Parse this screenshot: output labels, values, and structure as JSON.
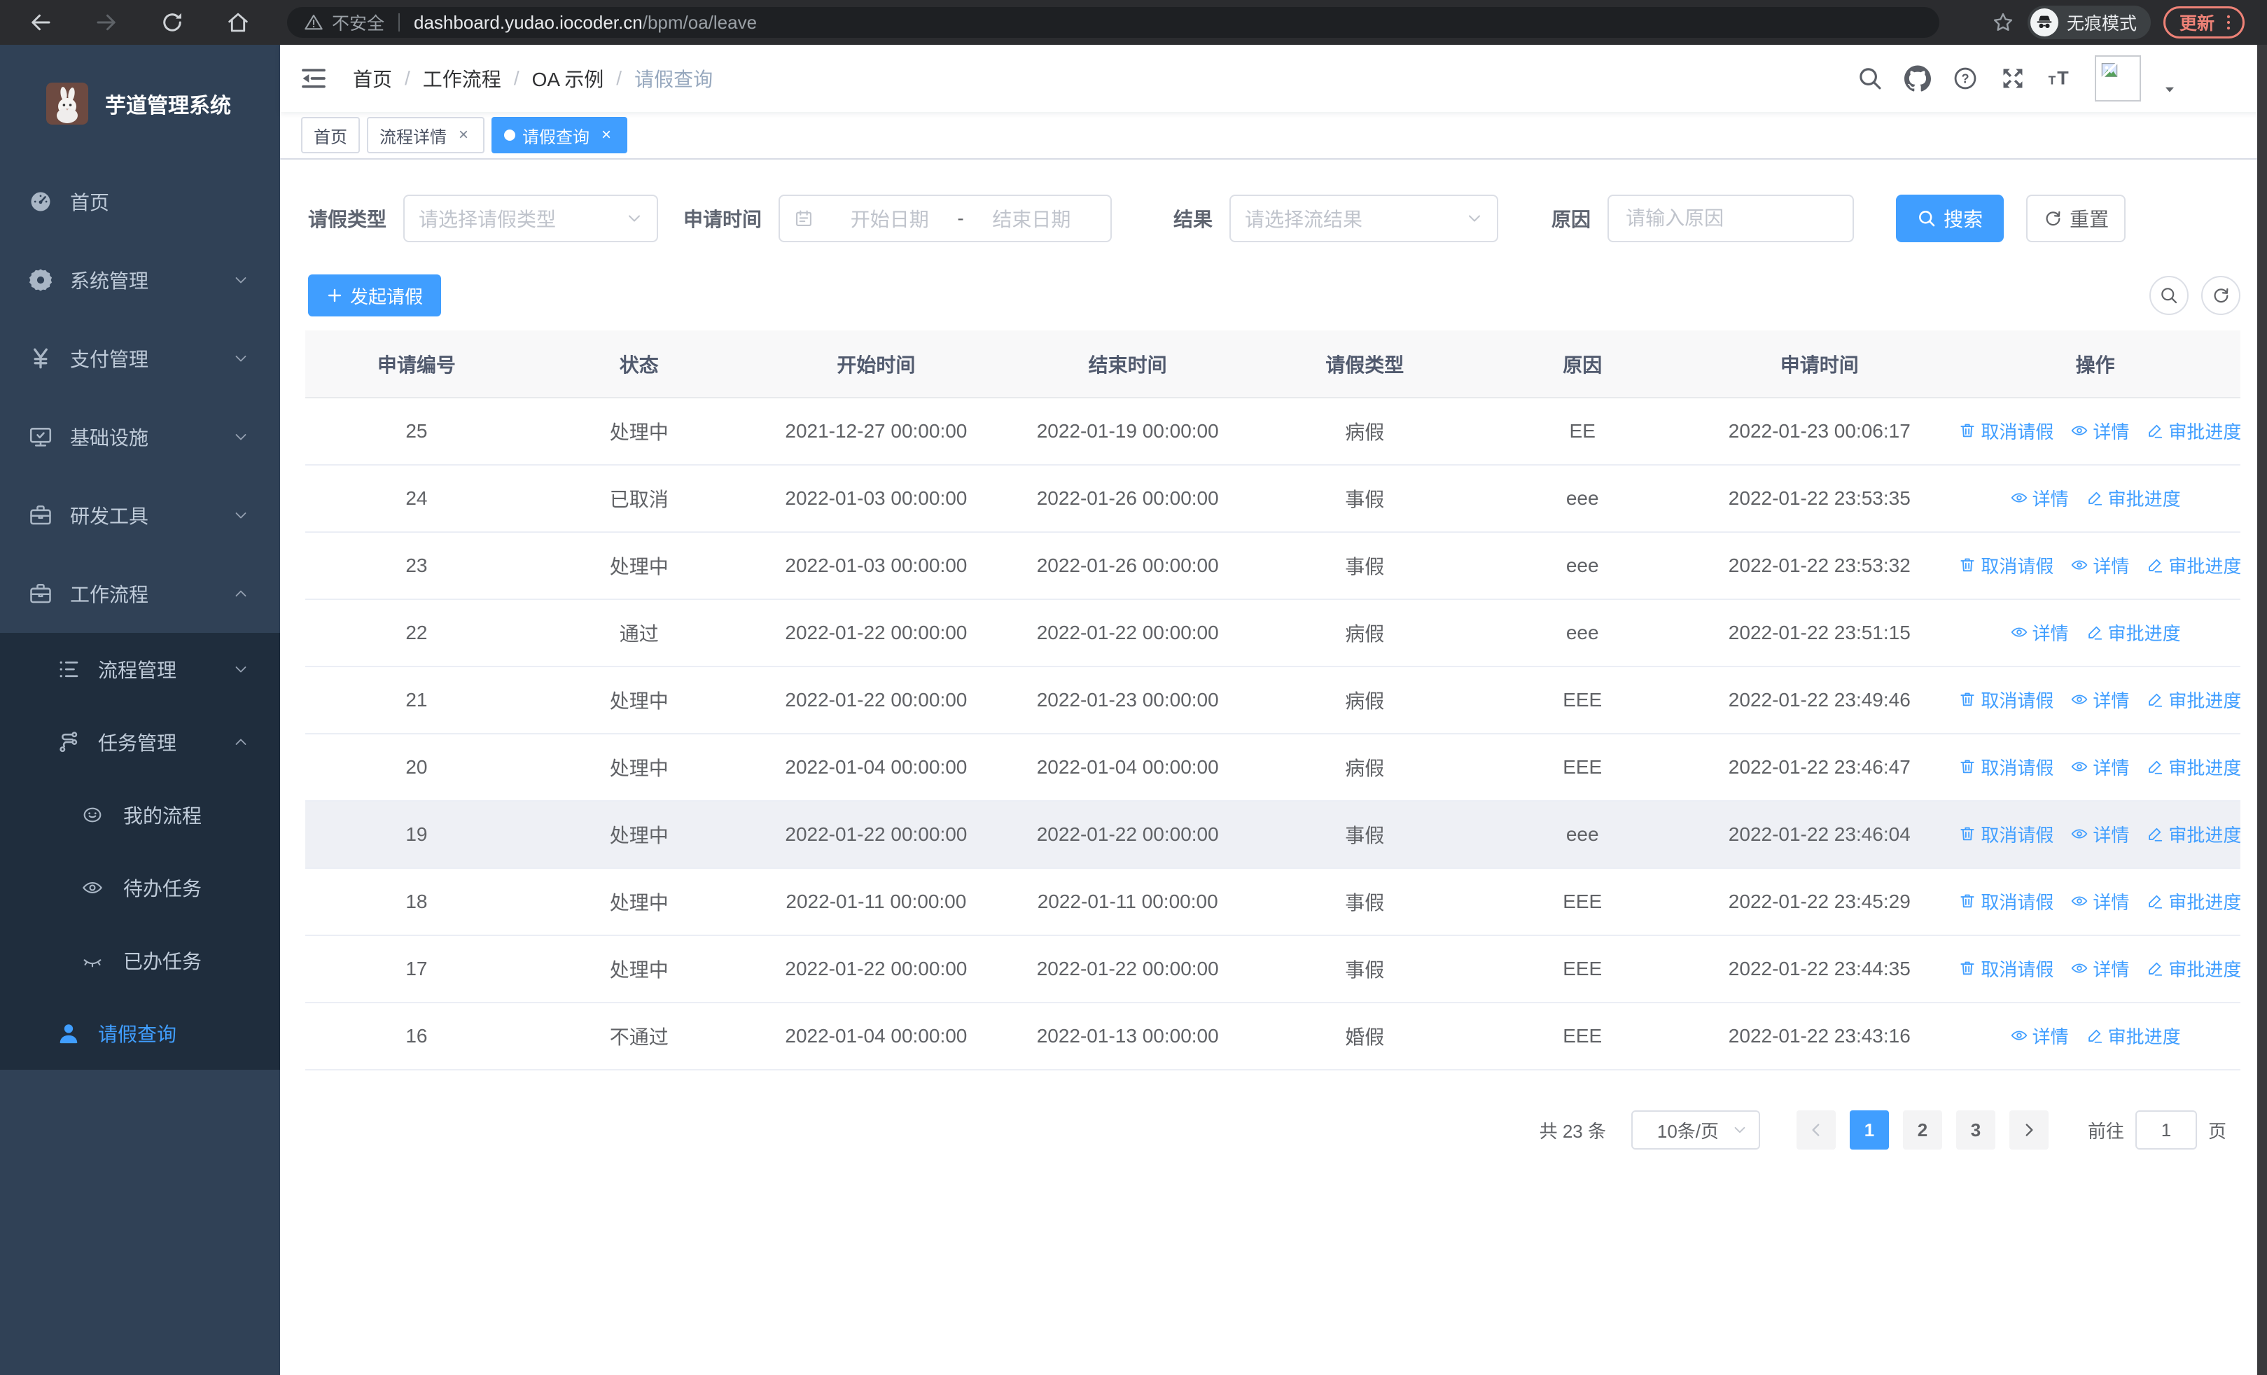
{
  "browser": {
    "security_label": "不安全",
    "url_host": "dashboard.yudao.iocoder.cn",
    "url_path": "/bpm/oa/leave",
    "incognito_label": "无痕模式",
    "update_label": "更新"
  },
  "colors": {
    "primary": "#409EFF",
    "sidebar_bg": "#304156",
    "submenu_bg": "#1f2d3d",
    "update_accent": "#ee8277"
  },
  "sidebar": {
    "app_title": "芋道管理系统",
    "items": [
      {
        "key": "home",
        "label": "首页",
        "icon": "dashboard-icon",
        "level": 1,
        "submenu": false,
        "chevron": "",
        "active": false
      },
      {
        "key": "system-management",
        "label": "系统管理",
        "icon": "gear-icon",
        "level": 1,
        "submenu": false,
        "chevron": "down",
        "active": false
      },
      {
        "key": "payment-management",
        "label": "支付管理",
        "icon": "yen-icon",
        "level": 1,
        "submenu": false,
        "chevron": "down",
        "active": false
      },
      {
        "key": "infrastructure",
        "label": "基础设施",
        "icon": "monitor-icon",
        "level": 1,
        "submenu": false,
        "chevron": "down",
        "active": false
      },
      {
        "key": "dev-tools",
        "label": "研发工具",
        "icon": "briefcase-icon",
        "level": 1,
        "submenu": false,
        "chevron": "down",
        "active": false
      },
      {
        "key": "workflow",
        "label": "工作流程",
        "icon": "briefcase-icon",
        "level": 1,
        "submenu": false,
        "chevron": "up",
        "active": false
      },
      {
        "key": "process-management",
        "label": "流程管理",
        "icon": "tree-list-icon",
        "level": 2,
        "submenu": true,
        "chevron": "down",
        "active": false
      },
      {
        "key": "task-management",
        "label": "任务管理",
        "icon": "flow-icon",
        "level": 2,
        "submenu": true,
        "chevron": "up",
        "active": false
      },
      {
        "key": "my-process",
        "label": "我的流程",
        "icon": "robot-face-icon",
        "level": 3,
        "submenu": true,
        "chevron": "",
        "active": false
      },
      {
        "key": "todo-tasks",
        "label": "待办任务",
        "icon": "eye-open-icon",
        "level": 3,
        "submenu": true,
        "chevron": "",
        "active": false
      },
      {
        "key": "done-tasks",
        "label": "已办任务",
        "icon": "eye-closed-icon",
        "level": 3,
        "submenu": true,
        "chevron": "",
        "active": false
      },
      {
        "key": "leave-query",
        "label": "请假查询",
        "icon": "user-icon",
        "level": 2,
        "submenu": true,
        "chevron": "",
        "active": true
      }
    ]
  },
  "breadcrumb": {
    "items": [
      "首页",
      "工作流程",
      "OA 示例",
      "请假查询"
    ]
  },
  "tabs": [
    {
      "key": "home-tab",
      "label": "首页",
      "closable": false,
      "active": false
    },
    {
      "key": "process-detail-tab",
      "label": "流程详情",
      "closable": true,
      "active": false
    },
    {
      "key": "leave-query-tab",
      "label": "请假查询",
      "closable": true,
      "active": true
    }
  ],
  "filters": {
    "leave_type_label": "请假类型",
    "leave_type_placeholder": "请选择请假类型",
    "apply_time_label": "申请时间",
    "start_date_placeholder": "开始日期",
    "range_separator": "-",
    "end_date_placeholder": "结束日期",
    "result_label": "结果",
    "result_placeholder": "请选择流结果",
    "reason_label": "原因",
    "reason_placeholder": "请输入原因",
    "search_label": "搜索",
    "reset_label": "重置"
  },
  "toolbar": {
    "create_label": "发起请假"
  },
  "table": {
    "columns": [
      "申请编号",
      "状态",
      "开始时间",
      "结束时间",
      "请假类型",
      "原因",
      "申请时间",
      "操作"
    ],
    "action_defs": {
      "cancel": {
        "label": "取消请假",
        "icon": "trash-icon",
        "name": "cancel-leave-link"
      },
      "detail": {
        "label": "详情",
        "icon": "eye-icon",
        "name": "detail-link"
      },
      "progress": {
        "label": "审批进度",
        "icon": "edit-icon",
        "name": "approval-progress-link"
      }
    },
    "rows": [
      {
        "id": "25",
        "status": "处理中",
        "start_time": "2021-12-27 00:00:00",
        "end_time": "2022-01-19 00:00:00",
        "leave_type": "病假",
        "reason": "EE",
        "apply_time": "2022-01-23 00:06:17",
        "actions": [
          "cancel",
          "detail",
          "progress"
        ],
        "highlight": false
      },
      {
        "id": "24",
        "status": "已取消",
        "start_time": "2022-01-03 00:00:00",
        "end_time": "2022-01-26 00:00:00",
        "leave_type": "事假",
        "reason": "eee",
        "apply_time": "2022-01-22 23:53:35",
        "actions": [
          "detail",
          "progress"
        ],
        "highlight": false
      },
      {
        "id": "23",
        "status": "处理中",
        "start_time": "2022-01-03 00:00:00",
        "end_time": "2022-01-26 00:00:00",
        "leave_type": "事假",
        "reason": "eee",
        "apply_time": "2022-01-22 23:53:32",
        "actions": [
          "cancel",
          "detail",
          "progress"
        ],
        "highlight": false
      },
      {
        "id": "22",
        "status": "通过",
        "start_time": "2022-01-22 00:00:00",
        "end_time": "2022-01-22 00:00:00",
        "leave_type": "病假",
        "reason": "eee",
        "apply_time": "2022-01-22 23:51:15",
        "actions": [
          "detail",
          "progress"
        ],
        "highlight": false
      },
      {
        "id": "21",
        "status": "处理中",
        "start_time": "2022-01-22 00:00:00",
        "end_time": "2022-01-23 00:00:00",
        "leave_type": "病假",
        "reason": "EEE",
        "apply_time": "2022-01-22 23:49:46",
        "actions": [
          "cancel",
          "detail",
          "progress"
        ],
        "highlight": false
      },
      {
        "id": "20",
        "status": "处理中",
        "start_time": "2022-01-04 00:00:00",
        "end_time": "2022-01-04 00:00:00",
        "leave_type": "病假",
        "reason": "EEE",
        "apply_time": "2022-01-22 23:46:47",
        "actions": [
          "cancel",
          "detail",
          "progress"
        ],
        "highlight": false
      },
      {
        "id": "19",
        "status": "处理中",
        "start_time": "2022-01-22 00:00:00",
        "end_time": "2022-01-22 00:00:00",
        "leave_type": "事假",
        "reason": "eee",
        "apply_time": "2022-01-22 23:46:04",
        "actions": [
          "cancel",
          "detail",
          "progress"
        ],
        "highlight": true
      },
      {
        "id": "18",
        "status": "处理中",
        "start_time": "2022-01-11 00:00:00",
        "end_time": "2022-01-11 00:00:00",
        "leave_type": "事假",
        "reason": "EEE",
        "apply_time": "2022-01-22 23:45:29",
        "actions": [
          "cancel",
          "detail",
          "progress"
        ],
        "highlight": false
      },
      {
        "id": "17",
        "status": "处理中",
        "start_time": "2022-01-22 00:00:00",
        "end_time": "2022-01-22 00:00:00",
        "leave_type": "事假",
        "reason": "EEE",
        "apply_time": "2022-01-22 23:44:35",
        "actions": [
          "cancel",
          "detail",
          "progress"
        ],
        "highlight": false
      },
      {
        "id": "16",
        "status": "不通过",
        "start_time": "2022-01-04 00:00:00",
        "end_time": "2022-01-13 00:00:00",
        "leave_type": "婚假",
        "reason": "EEE",
        "apply_time": "2022-01-22 23:43:16",
        "actions": [
          "detail",
          "progress"
        ],
        "highlight": false
      }
    ]
  },
  "pagination": {
    "total_label": "共 23 条",
    "page_size_label": "10条/页",
    "pages": [
      "1",
      "2",
      "3"
    ],
    "active_page": "1",
    "goto_label": "前往",
    "goto_value": "1",
    "page_unit": "页"
  }
}
